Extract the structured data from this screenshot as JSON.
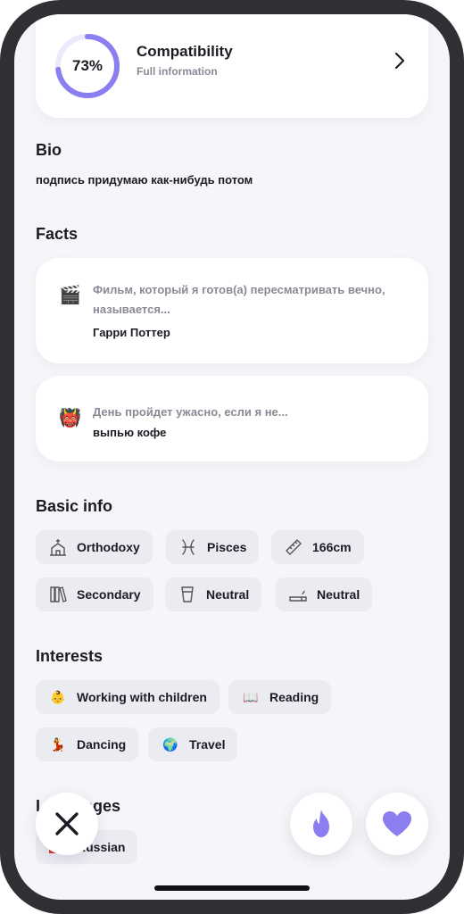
{
  "compatibility": {
    "percent_label": "73%",
    "percent_value": 73,
    "title": "Compatibility",
    "subtitle": "Full information"
  },
  "bio": {
    "title": "Bio",
    "text": "подпись придумаю как-нибудь потом"
  },
  "facts": {
    "title": "Facts",
    "items": [
      {
        "emoji": "🎬",
        "question": "Фильм, который я готов(а) пересматривать вечно, называется...",
        "answer": "Гарри Поттер"
      },
      {
        "emoji": "👹",
        "question": "День пройдет ужасно, если я не...",
        "answer": "выпью кофе"
      }
    ]
  },
  "basic_info": {
    "title": "Basic info",
    "items": [
      {
        "icon": "church-icon",
        "label": "Orthodoxy"
      },
      {
        "icon": "pisces-icon",
        "label": "Pisces"
      },
      {
        "icon": "ruler-icon",
        "label": "166cm"
      },
      {
        "icon": "books-icon",
        "label": "Secondary"
      },
      {
        "icon": "glass-icon",
        "label": "Neutral"
      },
      {
        "icon": "cigarette-icon",
        "label": "Neutral"
      }
    ]
  },
  "interests": {
    "title": "Interests",
    "items": [
      {
        "emoji": "👶",
        "label": "Working with children"
      },
      {
        "emoji": "📖",
        "label": "Reading"
      },
      {
        "emoji": "💃",
        "label": "Dancing"
      },
      {
        "emoji": "🌍",
        "label": "Travel"
      }
    ]
  },
  "languages": {
    "title": "Languages",
    "items": [
      {
        "label": "Russian"
      }
    ]
  },
  "actions": {
    "dislike_icon": "close-icon",
    "superlike_icon": "flame-icon",
    "like_icon": "heart-icon"
  },
  "colors": {
    "accent": "#8b7ef0",
    "ring_track": "#ece9fb",
    "background": "#f6f6fa",
    "chip": "#ebebf2"
  }
}
